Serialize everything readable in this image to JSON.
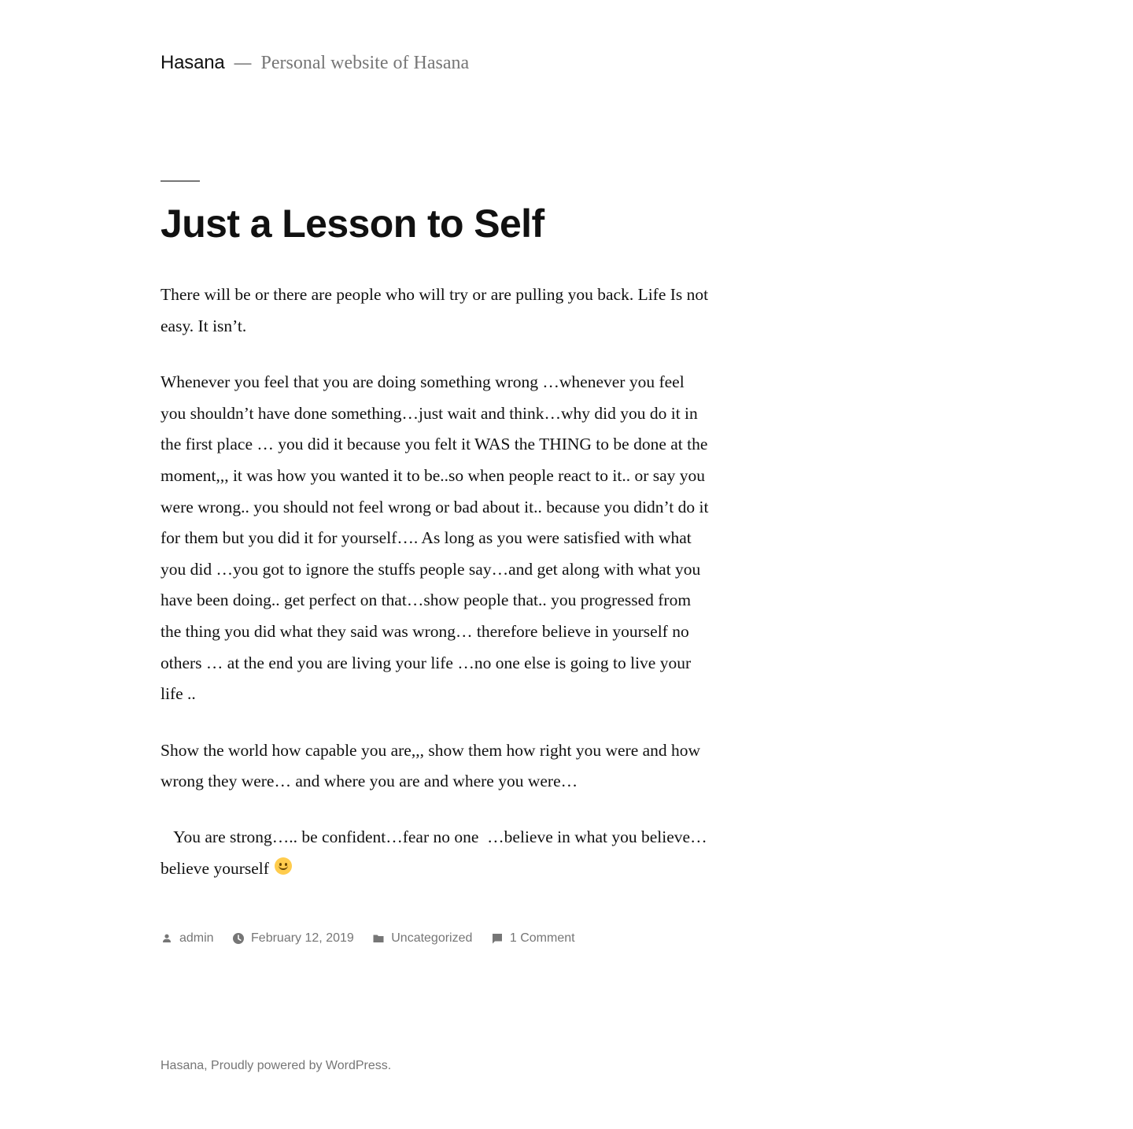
{
  "header": {
    "site_title": "Hasana",
    "separator": "—",
    "site_description": "Personal website of Hasana"
  },
  "post": {
    "title": "Just a Lesson to Self",
    "paragraphs": [
      "There will be or there are people who will try or are pulling you back. Life Is not easy. It isn’t.",
      "Whenever you feel that you are doing something wrong …whenever you feel you shouldn’t have done something…just wait and think…why did you do it in the first place … you did it because  you felt it WAS the THING to be done at the moment,,, it was how you wanted it to be..so when people react to it.. or say you were wrong.. you should not feel wrong or bad about it.. because you didn’t do it for them but you did it for yourself…. As long as you were satisfied with what you did …you got to ignore the stuffs people say…and get along with what you have been doing..  get perfect on that…show people that.. you progressed from the thing you did what they said was wrong… therefore believe in yourself no others … at the end you are living your life …no one else is going to live your life ..",
      "Show the world how capable you are,,, show them how right you were and how wrong they were… and where you are and where you were…",
      "   You are strong….. be confident…fear no one  …believe in what you believe… believe yourself "
    ],
    "meta": {
      "author": "admin",
      "date": "February 12, 2019",
      "category": "Uncategorized",
      "comments": "1 Comment"
    }
  },
  "footer": {
    "site_name": "Hasana",
    "separator": ", ",
    "powered_by": "Proudly powered by WordPress",
    "end": "."
  },
  "colors": {
    "text": "#111111",
    "secondary": "#767676",
    "background": "#ffffff",
    "emoji": "#ffcc4d"
  },
  "icons": [
    "person-icon",
    "clock-icon",
    "folder-icon",
    "comment-icon",
    "slightly-smiling-face-emoji"
  ]
}
